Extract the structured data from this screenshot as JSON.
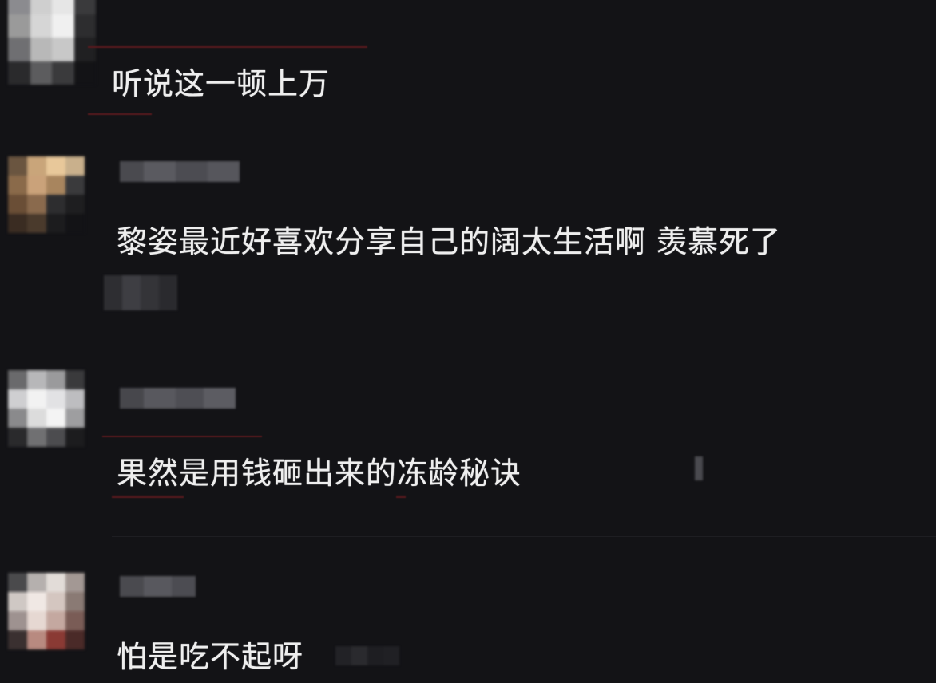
{
  "comments": [
    {
      "text": "听说这一顿上万"
    },
    {
      "text": "黎姿最近好喜欢分享自己的阔太生活啊 羡慕死了"
    },
    {
      "text": "果然是用钱砸出来的冻龄秘诀"
    },
    {
      "text": "怕是吃不起呀"
    }
  ],
  "colors": {
    "background": "#131316",
    "text": "#eeeeee",
    "divider": "#26262b"
  },
  "icons": {
    "avatar": "pixelated-avatar-icon"
  }
}
